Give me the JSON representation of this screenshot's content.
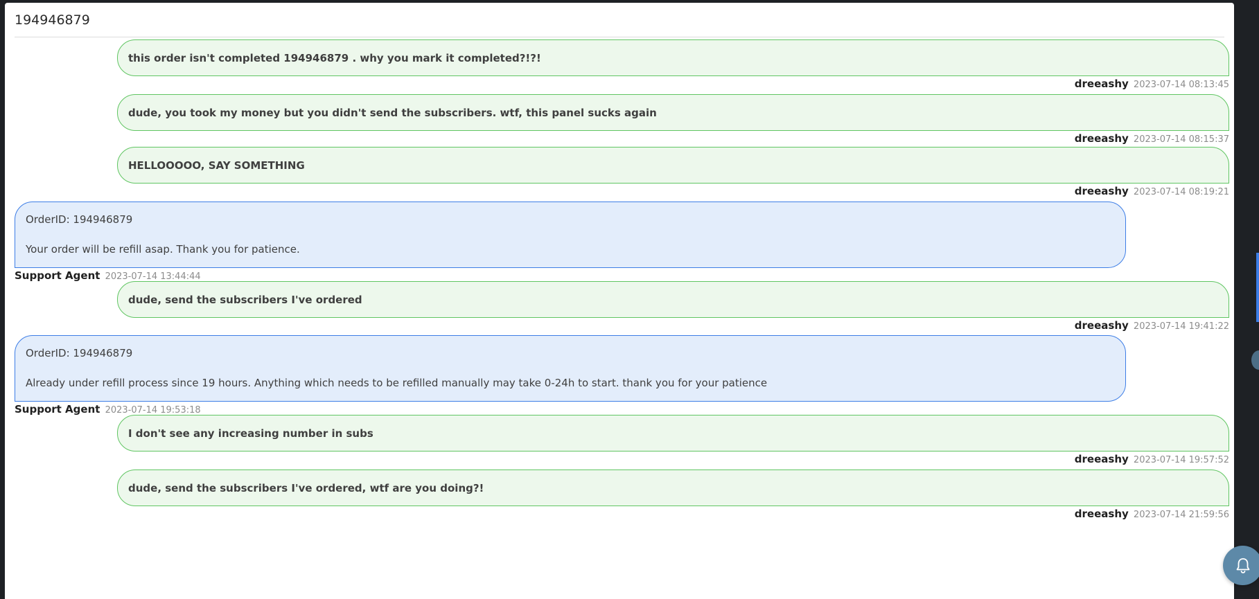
{
  "ticket": {
    "title": "194946879"
  },
  "messages": [
    {
      "type": "user",
      "text": "this order isn't completed 194946879 . why you mark it completed?!?!",
      "author": "dreeashy",
      "time": "2023-07-14 08:13:45"
    },
    {
      "type": "user",
      "text": "dude, you took my money but you didn't send the subscribers. wtf, this panel sucks again",
      "author": "dreeashy",
      "time": "2023-07-14 08:15:37"
    },
    {
      "type": "user",
      "text": "HELLOOOOO, SAY SOMETHING",
      "author": "dreeashy",
      "time": "2023-07-14 08:19:21"
    },
    {
      "type": "agent",
      "line1": "OrderID: 194946879",
      "line2": "Your order will be refill asap. Thank you for patience.",
      "author": "Support Agent",
      "time": "2023-07-14 13:44:44"
    },
    {
      "type": "user",
      "text": "dude, send the subscribers I've ordered",
      "author": "dreeashy",
      "time": "2023-07-14 19:41:22"
    },
    {
      "type": "agent",
      "line1": "OrderID: 194946879",
      "line2": "Already under refill process since 19 hours. Anything which needs to be refilled manually may take 0-24h to start. thank you for your patience",
      "author": "Support Agent",
      "time": "2023-07-14 19:53:18"
    },
    {
      "type": "user",
      "text": "I don't see any increasing number in subs",
      "author": "dreeashy",
      "time": "2023-07-14 19:57:52"
    },
    {
      "type": "user",
      "text": "dude, send the subscribers I've ordered, wtf are you doing?!",
      "author": "dreeashy",
      "time": "2023-07-14 21:59:56"
    }
  ],
  "notifications": {
    "icon": "bell-icon"
  },
  "colors": {
    "user_bubble_bg": "#edf8ec",
    "user_bubble_border": "#5fc561",
    "agent_bubble_bg": "#e3edfb",
    "agent_bubble_border": "#3c7de6",
    "bell_button": "#5d89a8"
  }
}
